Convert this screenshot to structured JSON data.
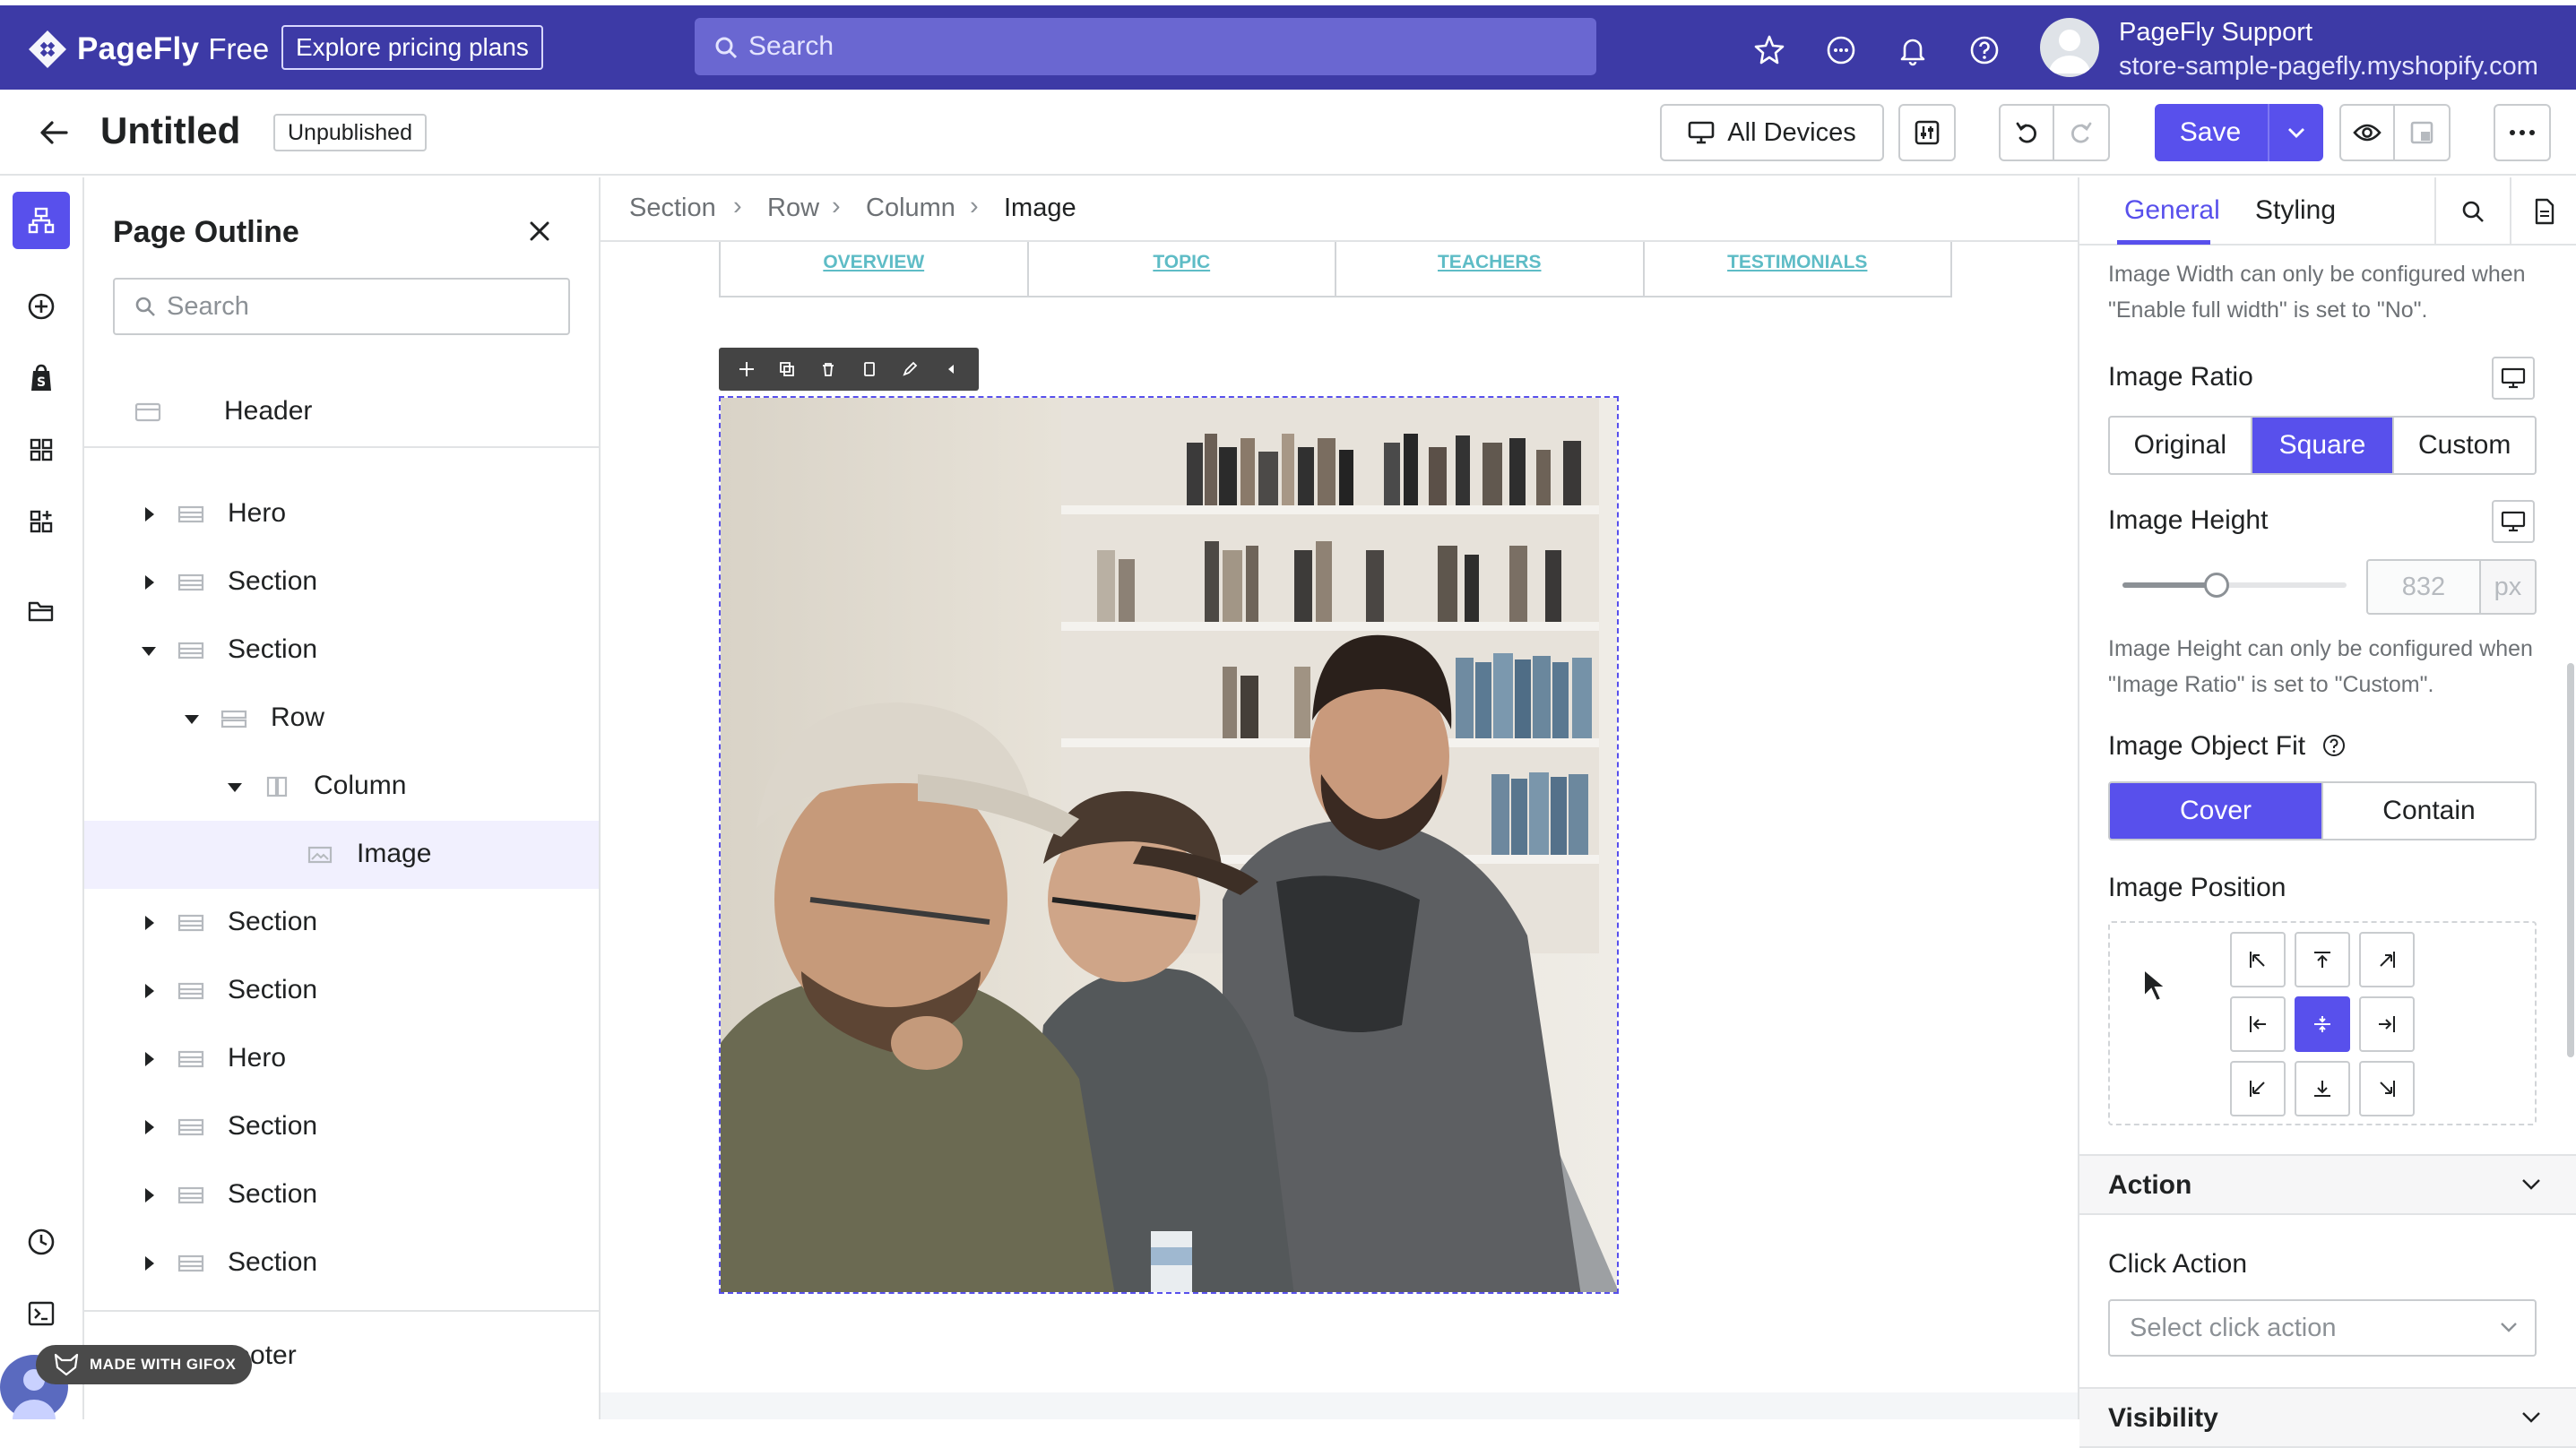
{
  "app": {
    "brand": "PageFly",
    "edition": "Free",
    "pricing_label": "Explore pricing plans",
    "search_placeholder": "Search"
  },
  "account": {
    "name": "PageFly Support",
    "store": "store-sample-pagefly.myshopify.com"
  },
  "document": {
    "title": "Untitled",
    "status": "Unpublished"
  },
  "toolbar": {
    "devices_label": "All Devices",
    "save_label": "Save"
  },
  "outline": {
    "title": "Page Outline",
    "search_placeholder": "Search",
    "items": [
      {
        "label": "Header"
      },
      {
        "label": "Hero"
      },
      {
        "label": "Section"
      },
      {
        "label": "Section"
      },
      {
        "label": "Row"
      },
      {
        "label": "Column"
      },
      {
        "label": "Image"
      },
      {
        "label": "Section"
      },
      {
        "label": "Section"
      },
      {
        "label": "Hero"
      },
      {
        "label": "Section"
      },
      {
        "label": "Section"
      },
      {
        "label": "Section"
      },
      {
        "label": "Footer"
      }
    ]
  },
  "badge": {
    "gifox": "MADE WITH GIFOX"
  },
  "breadcrumb": {
    "items": [
      "Section",
      "Row",
      "Column",
      "Image"
    ]
  },
  "canvas": {
    "tabs": [
      "OVERVIEW",
      "TOPIC",
      "TEACHERS",
      "TESTIMONIALS"
    ]
  },
  "panel": {
    "tabs": [
      "General",
      "Styling"
    ],
    "width_note": "Image Width can only be configured when \"Enable full width\" is set to \"No\".",
    "ratio": {
      "label": "Image Ratio",
      "options": [
        "Original",
        "Square",
        "Custom"
      ],
      "selected": "Square"
    },
    "height": {
      "label": "Image Height",
      "value": "832",
      "unit": "px",
      "slider_fraction": 0.42,
      "note": "Image Height can only be configured when \"Image Ratio\" is set to \"Custom\"."
    },
    "object_fit": {
      "label": "Image Object Fit",
      "options": [
        "Cover",
        "Contain"
      ],
      "selected": "Cover"
    },
    "position": {
      "label": "Image Position",
      "selected": "center"
    },
    "action": {
      "section_label": "Action",
      "click_label": "Click Action",
      "click_placeholder": "Select click action"
    },
    "visibility": {
      "section_label": "Visibility"
    }
  },
  "colors": {
    "brand": "#3d3aa6",
    "accent": "#5850ec",
    "link_teal": "#5ebcc6"
  }
}
